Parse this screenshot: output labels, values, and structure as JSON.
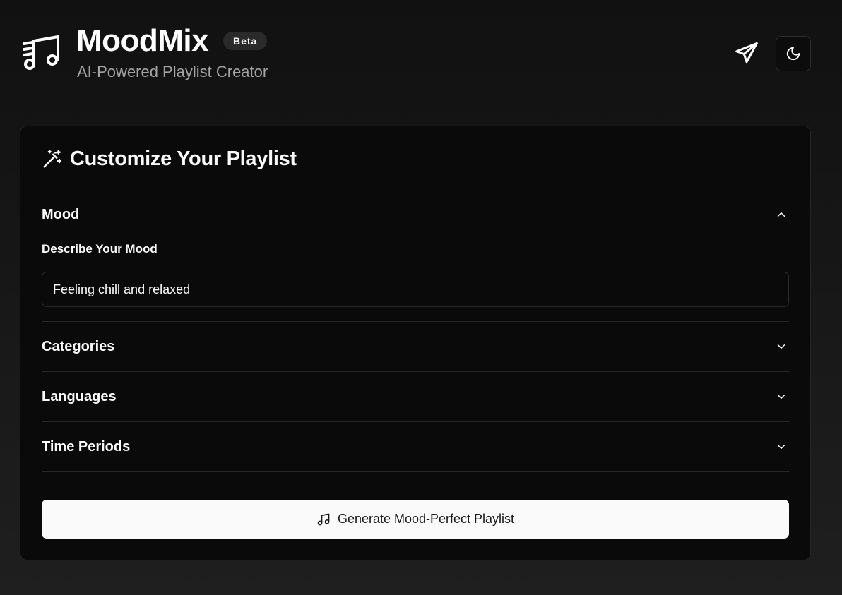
{
  "header": {
    "app_name": "MoodMix",
    "badge": "Beta",
    "subtitle": "AI-Powered Playlist Creator",
    "logo_icon": "music-list-icon",
    "send_icon": "send-icon",
    "theme_icon": "moon-icon"
  },
  "card": {
    "title": "Customize Your Playlist",
    "title_icon": "magic-wand-icon",
    "mood": {
      "label": "Mood",
      "expanded": true,
      "field_label": "Describe Your Mood",
      "input_value": "Feeling chill and relaxed"
    },
    "sections": [
      {
        "label": "Categories",
        "expanded": false
      },
      {
        "label": "Languages",
        "expanded": false
      },
      {
        "label": "Time Periods",
        "expanded": false
      }
    ],
    "generate_button": {
      "label": "Generate Mood-Perfect Playlist",
      "icon": "music-note-icon"
    }
  },
  "colors": {
    "background": "#111111",
    "card": "#0a0a0a",
    "border": "#262626",
    "text": "#fafafa",
    "muted_text": "#a3a3a3",
    "button_bg": "#fafafa"
  }
}
